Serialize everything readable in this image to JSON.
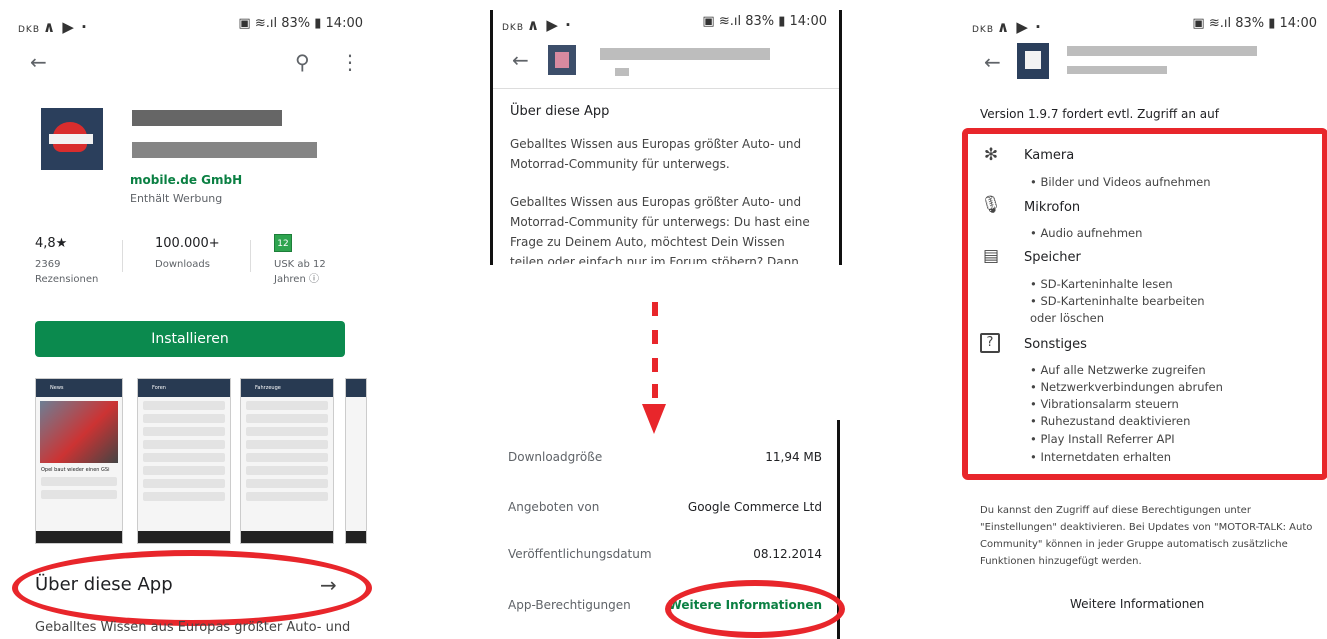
{
  "status_bar": {
    "carrier": "DKB",
    "signal_text": "83%",
    "time": "14:00"
  },
  "panel1": {
    "developer": "mobile.de GmbH",
    "ads_notice": "Enthält Werbung",
    "stats": {
      "rating_value": "4,8★",
      "rating_sub": "2369 Rezensionen",
      "downloads_value": "100.000+",
      "downloads_sub": "Downloads",
      "usk_badge": "12",
      "usk_sub": "USK ab 12 Jahren ⓘ"
    },
    "install_label": "Installieren",
    "screenshot_titles": [
      "News",
      "Foren",
      "Fahrzeuge"
    ],
    "screenshot_headline": "Opel baut wieder einen GSi",
    "about_title": "Über diese App",
    "about_arrow": "→",
    "description_cut": "Geballtes Wissen aus Europas größter Auto- und"
  },
  "panel2": {
    "about_title": "Über diese App",
    "desc1": "Geballtes Wissen aus Europas größter Auto- und Motorrad-Community für unterwegs.",
    "desc2": "Geballtes Wissen aus Europas größter Auto- und Motorrad-Community für unterwegs: Du hast eine Frage zu Deinem Auto, möchtest Dein Wissen teilen oder einfach nur im Forum stöbern? Dann ist die",
    "info": [
      {
        "label": "Downloadgröße",
        "value": "11,94 MB"
      },
      {
        "label": "Angeboten von",
        "value": "Google Commerce Ltd"
      },
      {
        "label": "Veröffentlichungsdatum",
        "value": "08.12.2014"
      }
    ],
    "permissions_label": "App-Berechtigungen",
    "permissions_link": "Weitere Informationen"
  },
  "panel3": {
    "version_note": "Version 1.9.7 fordert evtl. Zugriff an auf",
    "groups": [
      {
        "icon": "camera-icon",
        "title": "Kamera",
        "items": [
          "• Bilder und Videos aufnehmen"
        ]
      },
      {
        "icon": "microphone-icon",
        "title": "Mikrofon",
        "items": [
          "• Audio aufnehmen"
        ]
      },
      {
        "icon": "storage-icon",
        "title": "Speicher",
        "items": [
          "• SD-Karteninhalte lesen",
          "• SD-Karteninhalte bearbeiten",
          "oder löschen"
        ]
      },
      {
        "icon": "question-box-icon",
        "title": "Sonstiges",
        "items": [
          "• Auf alle Netzwerke zugreifen",
          "• Netzwerkverbindungen abrufen",
          "• Vibrationsalarm steuern",
          "• Ruhezustand deaktivieren",
          "• Play Install Referrer API",
          "• Internetdaten erhalten"
        ]
      }
    ],
    "footer_note": "Du kannst den Zugriff auf diese Berechtigungen unter \"Einstellungen\" deaktivieren. Bei Updates von \"MOTOR-TALK: Auto Community\" können in jeder Gruppe automatisch zusätzliche Funktionen hinzugefügt werden.",
    "more_info": "Weitere Informationen"
  },
  "colors": {
    "install_green": "#0b8a4e",
    "developer_green": "#0b8043",
    "highlight_red": "#e8262b"
  }
}
